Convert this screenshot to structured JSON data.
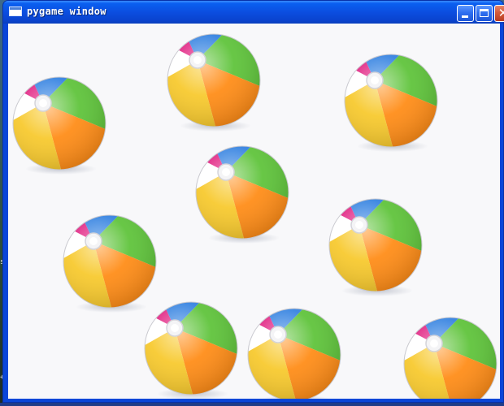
{
  "window": {
    "title": "pygame window",
    "icon": "app-window-icon",
    "controls": {
      "minimize_icon": "minimize-icon",
      "maximize_icon": "maximize-icon",
      "close_icon": "close-icon",
      "close_glyph": "✕"
    }
  },
  "canvas": {
    "background": "#f8f8fa",
    "sprite": "beach-ball-icon",
    "sprite_count": 9,
    "colors": {
      "magenta": "#e0197d",
      "blue": "#2f7fe0",
      "green": "#5bc236",
      "orange": "#ff8a12",
      "yellow": "#f7c829",
      "white": "#ffffff"
    }
  },
  "desktop": {
    "edge_text": [
      "s",
      "+"
    ]
  }
}
